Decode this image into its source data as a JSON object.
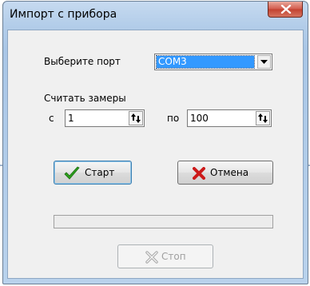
{
  "window": {
    "title": "Импорт с прибора"
  },
  "port": {
    "label": "Выберите порт",
    "selected": "COM3"
  },
  "range": {
    "label": "Считать замеры",
    "from_label": "с",
    "from_value": "1",
    "to_label": "по",
    "to_value": "100"
  },
  "buttons": {
    "start": "Старт",
    "cancel": "Отмена",
    "stop": "Стоп"
  },
  "progress": {
    "value": 0
  },
  "colors": {
    "start_icon": "#2ca01c",
    "cancel_icon": "#cc1a1a",
    "selection": "#3399ff"
  }
}
